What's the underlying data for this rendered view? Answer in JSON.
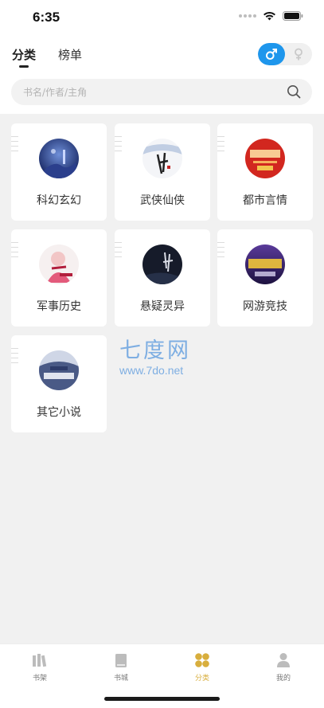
{
  "status_bar": {
    "time": "6:35"
  },
  "header": {
    "tabs": [
      {
        "label": "分类",
        "active": true
      },
      {
        "label": "榜单",
        "active": false
      }
    ],
    "gender_toggle": {
      "selected": "male",
      "accent": "#1e96ec"
    }
  },
  "search": {
    "placeholder": "书名/作者/主角",
    "icon": "search-icon"
  },
  "categories": [
    {
      "label": "科幻玄幻",
      "cover": "cover-scifi"
    },
    {
      "label": "武侠仙侠",
      "cover": "cover-wuxia"
    },
    {
      "label": "都市言情",
      "cover": "cover-romance"
    },
    {
      "label": "军事历史",
      "cover": "cover-military"
    },
    {
      "label": "悬疑灵异",
      "cover": "cover-mystery"
    },
    {
      "label": "网游竞技",
      "cover": "cover-gaming"
    },
    {
      "label": "其它小说",
      "cover": "cover-other"
    }
  ],
  "watermark": {
    "title": "七度网",
    "url": "www.7do.net"
  },
  "bottom_nav": {
    "accent": "#d8ae3d",
    "items": [
      {
        "label": "书架",
        "icon": "bookshelf-icon",
        "active": false
      },
      {
        "label": "书城",
        "icon": "bookstore-icon",
        "active": false
      },
      {
        "label": "分类",
        "icon": "category-icon",
        "active": true
      },
      {
        "label": "我的",
        "icon": "profile-icon",
        "active": false
      }
    ]
  }
}
